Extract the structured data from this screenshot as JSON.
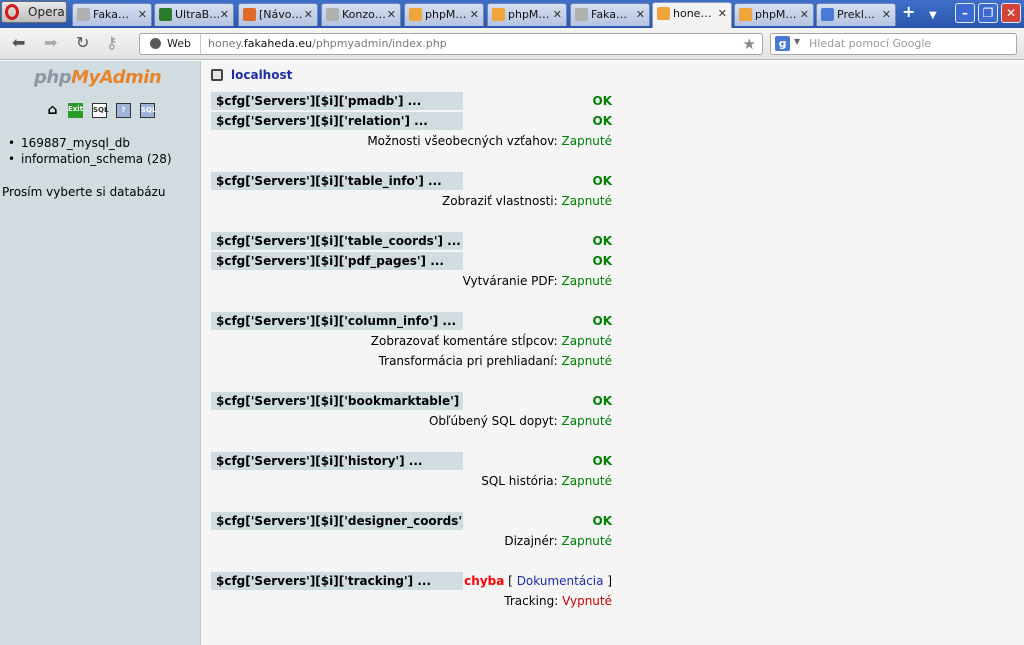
{
  "browser": {
    "menu_label": "Opera",
    "tabs": [
      {
        "label": "Faka…",
        "icon": "fakaheda-icon"
      },
      {
        "label": "UltraB…",
        "icon": "ultrabrowser-icon"
      },
      {
        "label": "[Návo…",
        "icon": "ubuntu-icon"
      },
      {
        "label": "Konzo…",
        "icon": "fakaheda-icon"
      },
      {
        "label": "phpM…",
        "icon": "pma-icon"
      },
      {
        "label": "phpM…",
        "icon": "pma-icon"
      },
      {
        "label": "Faka…",
        "icon": "fakaheda-icon"
      },
      {
        "label": "hone…",
        "icon": "pma-icon",
        "active": true
      },
      {
        "label": "phpM…",
        "icon": "pma-icon"
      },
      {
        "label": "Prekl…",
        "icon": "translate-icon"
      }
    ],
    "address": {
      "site_label": "Web",
      "url_prefix": "honey.",
      "url_domain": "fakaheda.eu",
      "url_path": "/phpmyadmin/index.php"
    },
    "search_placeholder": "Hledat pomocí Google"
  },
  "sidebar": {
    "logo_php": "php",
    "logo_myadmin": "MyAdmin",
    "databases": [
      "169887_mysql_db",
      "information_schema (28)"
    ],
    "choose_text": "Prosím vyberte si databázu"
  },
  "main": {
    "server_name": "localhost",
    "blocks": [
      {
        "rows": [
          {
            "key": "$cfg['Servers'][$i]['pmadb'] ...",
            "status": "OK"
          },
          {
            "key": "$cfg['Servers'][$i]['relation'] ...",
            "status": "OK"
          }
        ],
        "features": [
          {
            "label": "Možnosti všeobecných vzťahov:",
            "value": "Zapnuté"
          }
        ]
      },
      {
        "rows": [
          {
            "key": "$cfg['Servers'][$i]['table_info'] ...",
            "status": "OK"
          }
        ],
        "features": [
          {
            "label": "Zobraziť vlastnosti:",
            "value": "Zapnuté"
          }
        ]
      },
      {
        "rows": [
          {
            "key": "$cfg['Servers'][$i]['table_coords'] ...",
            "status": "OK"
          },
          {
            "key": "$cfg['Servers'][$i]['pdf_pages'] ...",
            "status": "OK"
          }
        ],
        "features": [
          {
            "label": "Vytváranie PDF:",
            "value": "Zapnuté"
          }
        ]
      },
      {
        "rows": [
          {
            "key": "$cfg['Servers'][$i]['column_info'] ...",
            "status": "OK"
          }
        ],
        "features": [
          {
            "label": "Zobrazovať komentáre stĺpcov:",
            "value": "Zapnuté"
          },
          {
            "label": "Transformácia pri prehliadaní:",
            "value": "Zapnuté"
          }
        ]
      },
      {
        "rows": [
          {
            "key": "$cfg['Servers'][$i]['bookmarktable'] ...",
            "status": "OK"
          }
        ],
        "features": [
          {
            "label": "Obľúbený SQL dopyt:",
            "value": "Zapnuté"
          }
        ]
      },
      {
        "rows": [
          {
            "key": "$cfg['Servers'][$i]['history'] ...",
            "status": "OK"
          }
        ],
        "features": [
          {
            "label": "SQL história:",
            "value": "Zapnuté"
          }
        ]
      },
      {
        "rows": [
          {
            "key": "$cfg['Servers'][$i]['designer_coords'] ...",
            "status": "OK"
          }
        ],
        "features": [
          {
            "label": "Dizajnér:",
            "value": "Zapnuté"
          }
        ]
      },
      {
        "rows": [
          {
            "key": "$cfg['Servers'][$i]['tracking'] ...",
            "status": "chyba",
            "doc_open": "[",
            "doc_link": "Dokumentácia",
            "doc_close": "]"
          }
        ],
        "features": [
          {
            "label": "Tracking:",
            "value": "Vypnuté",
            "off": true
          }
        ]
      }
    ]
  },
  "colors": {
    "sidebar_bg": "#d0dce0",
    "ok": "#008000",
    "error": "#ff0000",
    "link": "#1e2ea8",
    "logo_orange": "#e8842a"
  }
}
